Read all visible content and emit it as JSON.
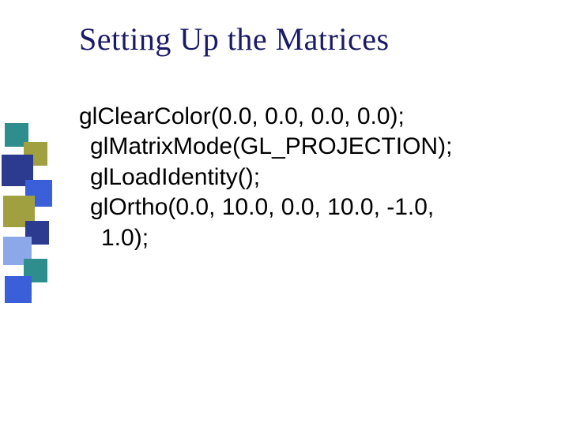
{
  "title": "Setting Up the Matrices",
  "code": {
    "line1": "glClearColor(0.0, 0.0, 0.0, 0.0);",
    "line2": "glMatrixMode(GL_PROJECTION);",
    "line3": "glLoadIdentity();",
    "line4": "glOrtho(0.0, 10.0, 0.0, 10.0, -1.0,",
    "line5": "1.0);"
  },
  "decor": {
    "colors": {
      "teal": "#2e8e8e",
      "olive": "#a0a040",
      "navy": "#2c3a8f",
      "blue": "#3a5fd9",
      "light": "#8da8e8"
    }
  }
}
